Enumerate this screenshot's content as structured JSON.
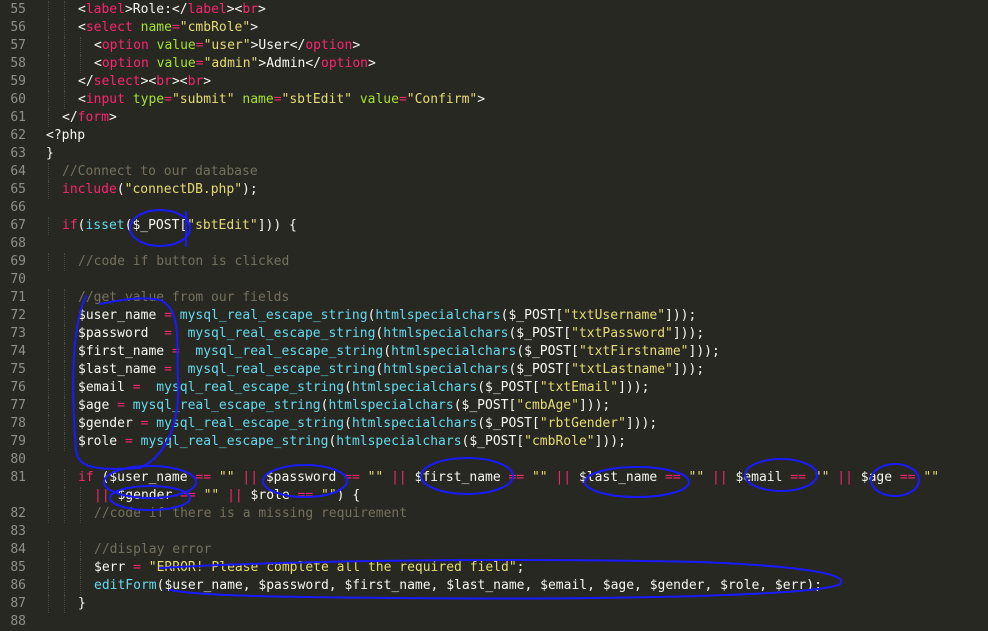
{
  "editor": {
    "lines": [
      {
        "n": "55",
        "indent": 2,
        "tokens": [
          [
            "pl",
            "<"
          ],
          [
            "tag",
            "label"
          ],
          [
            "pl",
            ">Role:</"
          ],
          [
            "tag",
            "label"
          ],
          [
            "pl",
            "><"
          ],
          [
            "tag",
            "br"
          ],
          [
            "pl",
            ">"
          ]
        ]
      },
      {
        "n": "56",
        "indent": 2,
        "tokens": [
          [
            "pl",
            "<"
          ],
          [
            "tag",
            "select"
          ],
          [
            "pl",
            " "
          ],
          [
            "attr",
            "name"
          ],
          [
            "op",
            "="
          ],
          [
            "str",
            "\"cmbRole\""
          ],
          [
            "pl",
            ">"
          ]
        ]
      },
      {
        "n": "57",
        "indent": 3,
        "tokens": [
          [
            "pl",
            "<"
          ],
          [
            "tag",
            "option"
          ],
          [
            "pl",
            " "
          ],
          [
            "attr",
            "value"
          ],
          [
            "op",
            "="
          ],
          [
            "str",
            "\"user\""
          ],
          [
            "pl",
            ">User</"
          ],
          [
            "tag",
            "option"
          ],
          [
            "pl",
            ">"
          ]
        ]
      },
      {
        "n": "58",
        "indent": 3,
        "tokens": [
          [
            "pl",
            "<"
          ],
          [
            "tag",
            "option"
          ],
          [
            "pl",
            " "
          ],
          [
            "attr",
            "value"
          ],
          [
            "op",
            "="
          ],
          [
            "str",
            "\"admin\""
          ],
          [
            "pl",
            ">Admin</"
          ],
          [
            "tag",
            "option"
          ],
          [
            "pl",
            ">"
          ]
        ]
      },
      {
        "n": "59",
        "indent": 2,
        "tokens": [
          [
            "pl",
            "</"
          ],
          [
            "tag",
            "select"
          ],
          [
            "pl",
            "><"
          ],
          [
            "tag",
            "br"
          ],
          [
            "pl",
            "><"
          ],
          [
            "tag",
            "br"
          ],
          [
            "pl",
            ">"
          ]
        ]
      },
      {
        "n": "60",
        "indent": 2,
        "tokens": [
          [
            "pl",
            "<"
          ],
          [
            "tag",
            "input"
          ],
          [
            "pl",
            " "
          ],
          [
            "attr",
            "type"
          ],
          [
            "op",
            "="
          ],
          [
            "str",
            "\"submit\""
          ],
          [
            "pl",
            " "
          ],
          [
            "attr",
            "name"
          ],
          [
            "op",
            "="
          ],
          [
            "str",
            "\"sbtEdit\""
          ],
          [
            "pl",
            " "
          ],
          [
            "attr",
            "value"
          ],
          [
            "op",
            "="
          ],
          [
            "str",
            "\"Confirm\""
          ],
          [
            "pl",
            ">"
          ]
        ]
      },
      {
        "n": "61",
        "indent": 1,
        "tokens": [
          [
            "pl",
            "</"
          ],
          [
            "tag",
            "form"
          ],
          [
            "pl",
            ">"
          ]
        ]
      },
      {
        "n": "62",
        "indent": 0,
        "tokens": [
          [
            "pl",
            "<?php"
          ]
        ]
      },
      {
        "n": "63",
        "indent": 0,
        "tokens": [
          [
            "pl",
            "}"
          ]
        ]
      },
      {
        "n": "64",
        "indent": 1,
        "tokens": [
          [
            "cm",
            "//Connect to our database"
          ]
        ]
      },
      {
        "n": "65",
        "indent": 1,
        "tokens": [
          [
            "kw",
            "include"
          ],
          [
            "pl",
            "("
          ],
          [
            "str",
            "\"connectDB.php\""
          ],
          [
            "pl",
            ");"
          ]
        ]
      },
      {
        "n": "66",
        "indent": 0,
        "tokens": []
      },
      {
        "n": "67",
        "indent": 1,
        "tokens": [
          [
            "kw",
            "if"
          ],
          [
            "pl",
            "("
          ],
          [
            "fn",
            "isset"
          ],
          [
            "pl",
            "($_POST["
          ],
          [
            "str",
            "\"sbtEdit\""
          ],
          [
            "pl",
            "])) {"
          ]
        ]
      },
      {
        "n": "68",
        "indent": 0,
        "tokens": []
      },
      {
        "n": "69",
        "indent": 2,
        "tokens": [
          [
            "cm",
            "//code if button is clicked"
          ]
        ]
      },
      {
        "n": "70",
        "indent": 0,
        "tokens": []
      },
      {
        "n": "71",
        "indent": 2,
        "tokens": [
          [
            "cm",
            "//get value from our fields"
          ]
        ]
      },
      {
        "n": "72",
        "indent": 2,
        "tokens": [
          [
            "pl",
            "$user_name "
          ],
          [
            "op",
            "="
          ],
          [
            "pl",
            " "
          ],
          [
            "fn",
            "mysql_real_escape_string"
          ],
          [
            "pl",
            "("
          ],
          [
            "fn",
            "htmlspecialchars"
          ],
          [
            "pl",
            "($_POST["
          ],
          [
            "str",
            "\"txtUsername\""
          ],
          [
            "pl",
            "]));"
          ]
        ]
      },
      {
        "n": "73",
        "indent": 2,
        "tokens": [
          [
            "pl",
            "$password  "
          ],
          [
            "op",
            "="
          ],
          [
            "pl",
            "  "
          ],
          [
            "fn",
            "mysql_real_escape_string"
          ],
          [
            "pl",
            "("
          ],
          [
            "fn",
            "htmlspecialchars"
          ],
          [
            "pl",
            "($_POST["
          ],
          [
            "str",
            "\"txtPassword\""
          ],
          [
            "pl",
            "]));"
          ]
        ]
      },
      {
        "n": "74",
        "indent": 2,
        "tokens": [
          [
            "pl",
            "$first_name "
          ],
          [
            "op",
            "="
          ],
          [
            "pl",
            "  "
          ],
          [
            "fn",
            "mysql_real_escape_string"
          ],
          [
            "pl",
            "("
          ],
          [
            "fn",
            "htmlspecialchars"
          ],
          [
            "pl",
            "($_POST["
          ],
          [
            "str",
            "\"txtFirstname\""
          ],
          [
            "pl",
            "]));"
          ]
        ]
      },
      {
        "n": "75",
        "indent": 2,
        "tokens": [
          [
            "pl",
            "$last_name "
          ],
          [
            "op",
            "="
          ],
          [
            "pl",
            "  "
          ],
          [
            "fn",
            "mysql_real_escape_string"
          ],
          [
            "pl",
            "("
          ],
          [
            "fn",
            "htmlspecialchars"
          ],
          [
            "pl",
            "($_POST["
          ],
          [
            "str",
            "\"txtLastname\""
          ],
          [
            "pl",
            "]));"
          ]
        ]
      },
      {
        "n": "76",
        "indent": 2,
        "tokens": [
          [
            "pl",
            "$email "
          ],
          [
            "op",
            "="
          ],
          [
            "pl",
            "  "
          ],
          [
            "fn",
            "mysql_real_escape_string"
          ],
          [
            "pl",
            "("
          ],
          [
            "fn",
            "htmlspecialchars"
          ],
          [
            "pl",
            "($_POST["
          ],
          [
            "str",
            "\"txtEmail\""
          ],
          [
            "pl",
            "]));"
          ]
        ]
      },
      {
        "n": "77",
        "indent": 2,
        "tokens": [
          [
            "pl",
            "$age "
          ],
          [
            "op",
            "="
          ],
          [
            "pl",
            " "
          ],
          [
            "fn",
            "mysql_real_escape_string"
          ],
          [
            "pl",
            "("
          ],
          [
            "fn",
            "htmlspecialchars"
          ],
          [
            "pl",
            "($_POST["
          ],
          [
            "str",
            "\"cmbAge\""
          ],
          [
            "pl",
            "]));"
          ]
        ]
      },
      {
        "n": "78",
        "indent": 2,
        "tokens": [
          [
            "pl",
            "$gender "
          ],
          [
            "op",
            "="
          ],
          [
            "pl",
            " "
          ],
          [
            "fn",
            "mysql_real_escape_string"
          ],
          [
            "pl",
            "("
          ],
          [
            "fn",
            "htmlspecialchars"
          ],
          [
            "pl",
            "($_POST["
          ],
          [
            "str",
            "\"rbtGender\""
          ],
          [
            "pl",
            "]));"
          ]
        ]
      },
      {
        "n": "79",
        "indent": 2,
        "tokens": [
          [
            "pl",
            "$role "
          ],
          [
            "op",
            "="
          ],
          [
            "pl",
            " "
          ],
          [
            "fn",
            "mysql_real_escape_string"
          ],
          [
            "pl",
            "("
          ],
          [
            "fn",
            "htmlspecialchars"
          ],
          [
            "pl",
            "($_POST["
          ],
          [
            "str",
            "\"cmbRole\""
          ],
          [
            "pl",
            "]));"
          ]
        ]
      },
      {
        "n": "80",
        "indent": 0,
        "tokens": []
      },
      {
        "n": "81",
        "indent": 2,
        "tokens": [
          [
            "kw",
            "if"
          ],
          [
            "pl",
            " ($user_name "
          ],
          [
            "op",
            "=="
          ],
          [
            "pl",
            " "
          ],
          [
            "str",
            "\"\""
          ],
          [
            "pl",
            " "
          ],
          [
            "op",
            "||"
          ],
          [
            "pl",
            " $password "
          ],
          [
            "op",
            "=="
          ],
          [
            "pl",
            " "
          ],
          [
            "str",
            "\"\""
          ],
          [
            "pl",
            " "
          ],
          [
            "op",
            "||"
          ],
          [
            "pl",
            " $first_name "
          ],
          [
            "op",
            "=="
          ],
          [
            "pl",
            " "
          ],
          [
            "str",
            "\"\""
          ],
          [
            "pl",
            " "
          ],
          [
            "op",
            "||"
          ],
          [
            "pl",
            " $last_name "
          ],
          [
            "op",
            "=="
          ],
          [
            "pl",
            " "
          ],
          [
            "str",
            "\"\""
          ],
          [
            "pl",
            " "
          ],
          [
            "op",
            "||"
          ],
          [
            "pl",
            " $email "
          ],
          [
            "op",
            "=="
          ],
          [
            "pl",
            " "
          ],
          [
            "str",
            "\"\""
          ],
          [
            "pl",
            " "
          ],
          [
            "op",
            "||"
          ],
          [
            "pl",
            " $age "
          ],
          [
            "op",
            "=="
          ],
          [
            "pl",
            " "
          ],
          [
            "str",
            "\"\""
          ]
        ]
      },
      {
        "n": "",
        "indent": 3,
        "tokens": [
          [
            "op",
            "||"
          ],
          [
            "pl",
            " $gender "
          ],
          [
            "op",
            "=="
          ],
          [
            "pl",
            " "
          ],
          [
            "str",
            "\"\""
          ],
          [
            "pl",
            " "
          ],
          [
            "op",
            "||"
          ],
          [
            "pl",
            " $role "
          ],
          [
            "op",
            "=="
          ],
          [
            "pl",
            " "
          ],
          [
            "str",
            "\"\""
          ],
          [
            "pl",
            ") {"
          ]
        ]
      },
      {
        "n": "82",
        "indent": 3,
        "tokens": [
          [
            "cm",
            "//code if there is a missing requirement"
          ]
        ]
      },
      {
        "n": "83",
        "indent": 0,
        "tokens": []
      },
      {
        "n": "84",
        "indent": 3,
        "tokens": [
          [
            "cm",
            "//display error"
          ]
        ]
      },
      {
        "n": "85",
        "indent": 3,
        "tokens": [
          [
            "pl",
            "$err "
          ],
          [
            "op",
            "="
          ],
          [
            "pl",
            " "
          ],
          [
            "str",
            "\"ERROR! Please complete all the required field\""
          ],
          [
            "pl",
            ";"
          ]
        ]
      },
      {
        "n": "86",
        "indent": 3,
        "tokens": [
          [
            "fn",
            "editForm"
          ],
          [
            "pl",
            "($user_name, $password, $first_name, $last_name, $email, $age, $gender, $role, $err);"
          ]
        ]
      },
      {
        "n": "87",
        "indent": 2,
        "tokens": [
          [
            "pl",
            "}"
          ]
        ]
      },
      {
        "n": "88",
        "indent": 0,
        "tokens": []
      }
    ]
  },
  "colors": {
    "background": "#272822",
    "annotation": "#1a1aff"
  }
}
